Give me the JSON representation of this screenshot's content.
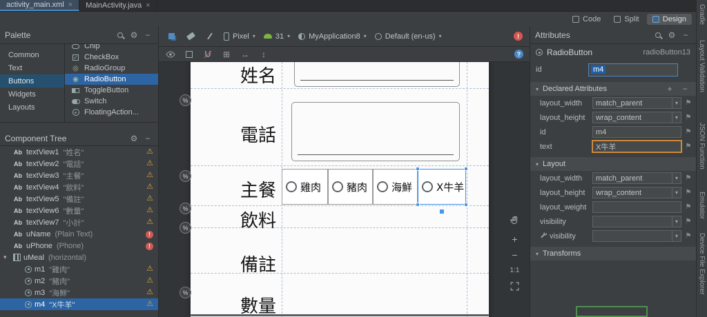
{
  "icons": {
    "ab": "Ab",
    "gear": "⚙",
    "minus": "−",
    "plus": "+",
    "close": "×",
    "chevron_down": "▾",
    "warning": "⚠",
    "error": "!",
    "percent": "%",
    "help": "?",
    "arrow_h": "↔",
    "arrow_v": "↕",
    "margin": "⊞",
    "flag": "⚑"
  },
  "window": {
    "tabs": [
      {
        "label": "activity_main.xml"
      },
      {
        "label": "MainActivity.java"
      }
    ],
    "view_modes": [
      {
        "label": "Code"
      },
      {
        "label": "Split"
      },
      {
        "label": "Design"
      }
    ]
  },
  "palette": {
    "title": "Palette",
    "categories": [
      {
        "label": "Common"
      },
      {
        "label": "Text"
      },
      {
        "label": "Buttons"
      },
      {
        "label": "Widgets"
      },
      {
        "label": "Layouts"
      }
    ],
    "items": [
      {
        "label": "Chip"
      },
      {
        "label": "CheckBox"
      },
      {
        "label": "RadioGroup"
      },
      {
        "label": "RadioButton"
      },
      {
        "label": "ToggleButton"
      },
      {
        "label": "Switch"
      },
      {
        "label": "FloatingAction..."
      }
    ]
  },
  "design_toolbar": {
    "device": "Pixel",
    "api_level": "31",
    "theme": "MyApplication8",
    "locale": "Default (en-us)"
  },
  "component_tree": {
    "title": "Component Tree",
    "items": [
      {
        "name": "textView1",
        "detail": "\"姓名\""
      },
      {
        "name": "textView2",
        "detail": "\"電話\""
      },
      {
        "name": "textView3",
        "detail": "\"主餐\""
      },
      {
        "name": "textView4",
        "detail": "\"飲料\""
      },
      {
        "name": "textView5",
        "detail": "\"備註\""
      },
      {
        "name": "textView6",
        "detail": "\"數量\""
      },
      {
        "name": "textView7",
        "detail": "\"小計\""
      },
      {
        "name": "uName",
        "detail": "(Plain Text)"
      },
      {
        "name": "uPhone",
        "detail": "(Phone)"
      },
      {
        "name": "uMeal",
        "detail": "(horizontal)"
      },
      {
        "name": "m1",
        "detail": "\"雞肉\""
      },
      {
        "name": "m2",
        "detail": "\"豬肉\""
      },
      {
        "name": "m3",
        "detail": "\"海鮮\""
      },
      {
        "name": "m4",
        "detail": "\"X牛羊\""
      }
    ]
  },
  "canvas": {
    "form": {
      "name_label": "姓名",
      "phone_label": "電話",
      "meal_label": "主餐",
      "drink_label": "飲料",
      "note_label": "備註",
      "qty_label": "數量",
      "radios": [
        {
          "label": "雞肉"
        },
        {
          "label": "豬肉"
        },
        {
          "label": "海鮮"
        },
        {
          "label": "X牛羊"
        }
      ]
    },
    "zoom_controls": {
      "ratio": "1:1"
    }
  },
  "attributes": {
    "title": "Attributes",
    "component_type": "RadioButton",
    "component_name": "radioButton13",
    "id_label": "id",
    "id_value": "m4",
    "declared": {
      "title": "Declared Attributes",
      "rows": [
        {
          "label": "layout_width",
          "value": "match_parent"
        },
        {
          "label": "layout_height",
          "value": "wrap_content"
        },
        {
          "label": "id",
          "value": "m4"
        },
        {
          "label": "text",
          "value": "X牛羊"
        }
      ]
    },
    "layout": {
      "title": "Layout",
      "rows": [
        {
          "label": "layout_width",
          "value": "match_parent"
        },
        {
          "label": "layout_height",
          "value": "wrap_content"
        },
        {
          "label": "layout_weight",
          "value": ""
        },
        {
          "label": "visibility",
          "value": ""
        },
        {
          "label": "visibility",
          "value": ""
        }
      ]
    },
    "transforms": {
      "title": "Transforms"
    }
  },
  "right_strip": {
    "tabs": [
      {
        "label": "Gradle"
      },
      {
        "label": "Layout Validation"
      },
      {
        "label": "JSON Function"
      },
      {
        "label": "Emulator"
      },
      {
        "label": "Device File Explorer"
      }
    ]
  }
}
